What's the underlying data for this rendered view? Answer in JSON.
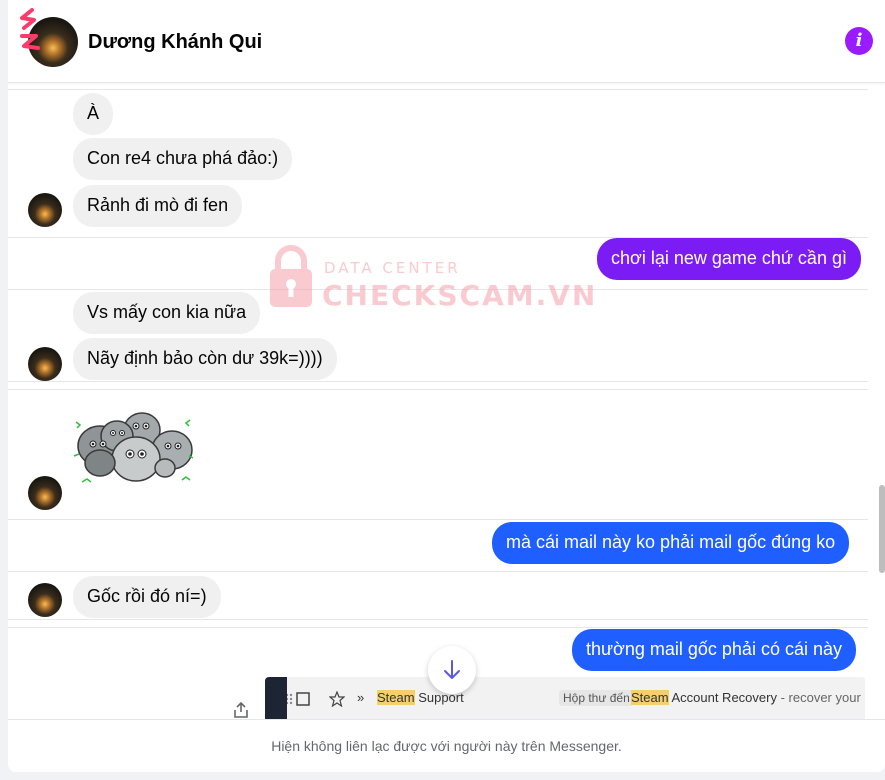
{
  "header": {
    "contact_name": "Dương Khánh Qui",
    "avatar_icon": "profile-photo",
    "info_icon": "info-icon",
    "info_glyph": "i"
  },
  "watermark": {
    "line1": "DATA CENTER",
    "line2": "CHECKSCAM.VN"
  },
  "messages": [
    {
      "direction": "incoming",
      "text": "À"
    },
    {
      "direction": "incoming",
      "text": "Con re4 chưa phá đảo:)"
    },
    {
      "direction": "incoming",
      "text": "Rảnh đi mò đi fen"
    },
    {
      "direction": "outgoing",
      "text": "chơi lại new game chứ cần gì"
    },
    {
      "direction": "incoming",
      "text": "Vs mấy con kia nữa"
    },
    {
      "direction": "incoming",
      "text": "Nãy định bảo còn dư 39k=))))"
    },
    {
      "direction": "incoming",
      "type": "sticker",
      "sticker": "rocks-group-sticker"
    },
    {
      "direction": "outgoing",
      "text": "mà cái mail này ko phải mail gốc đúng ko"
    },
    {
      "direction": "incoming",
      "text": "Gốc rồi đó ní=)"
    },
    {
      "direction": "outgoing",
      "text": "thường mail gốc phải có cái này"
    }
  ],
  "attachment": {
    "chevrons": "»",
    "sender_highlight": "Steam",
    "sender_rest": " Support",
    "inbox_chip": "Hộp thư đến",
    "subject_highlight": "Steam",
    "subject_rest": " Account Recovery",
    "snippet": "- recover your S"
  },
  "footer": {
    "notice": "Hiện không liên lạc được với người này trên Messenger."
  },
  "colors": {
    "outgoing_purple": "#7b1cf5",
    "outgoing_blue": "#1f5fff",
    "incoming_bubble": "#f0f0f0",
    "info_button": "#9b1bff",
    "highlight": "#f5d06a"
  }
}
